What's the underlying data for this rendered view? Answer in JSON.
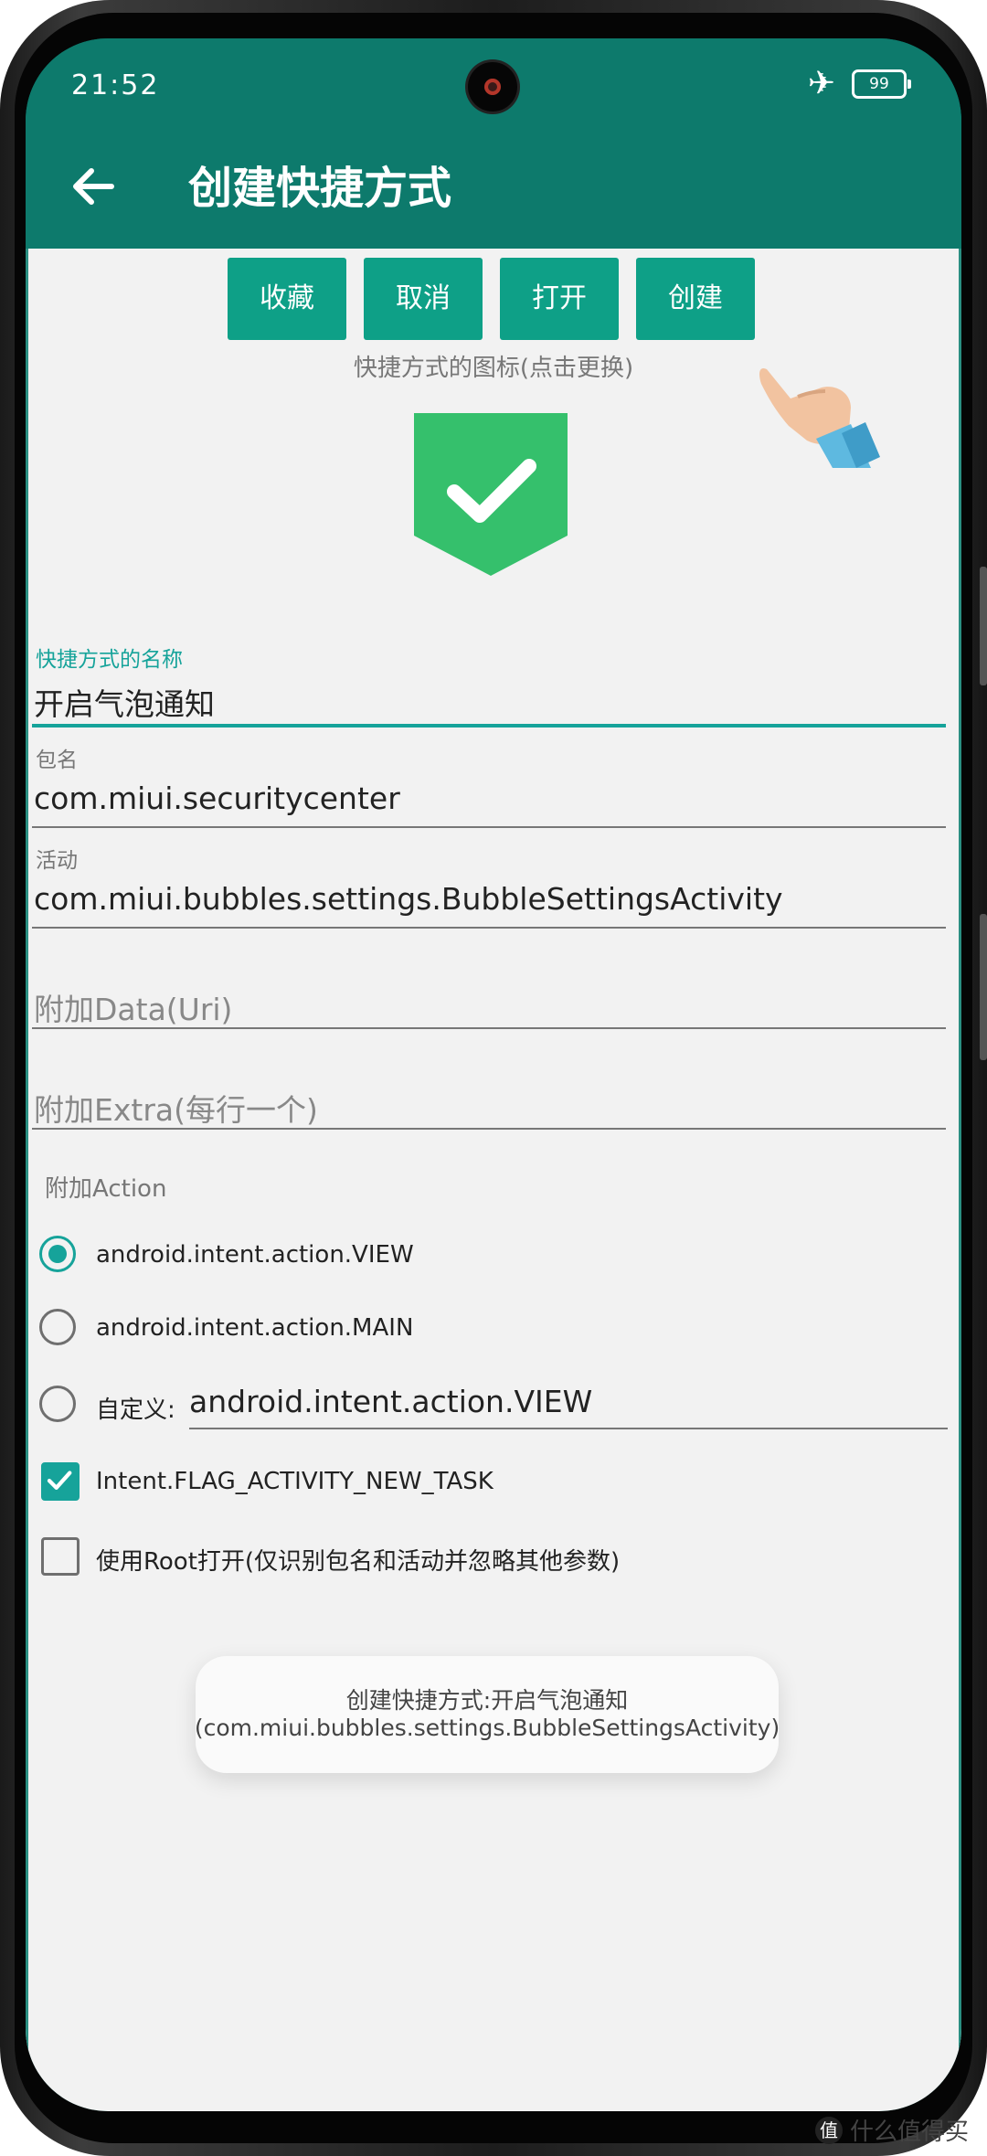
{
  "status_bar": {
    "time": "21:52",
    "battery": "99"
  },
  "app_bar": {
    "title": "创建快捷方式"
  },
  "buttons": {
    "favorite": "收藏",
    "cancel": "取消",
    "open": "打开",
    "create": "创建"
  },
  "icon_hint": "快捷方式的图标(点击更换)",
  "fields": {
    "name": {
      "label": "快捷方式的名称",
      "value": "开启气泡通知"
    },
    "package": {
      "label": "包名",
      "value": "com.miui.securitycenter"
    },
    "activity": {
      "label": "活动",
      "value": "com.miui.bubbles.settings.BubbleSettingsActivity"
    },
    "data": {
      "placeholder": "附加Data(Uri)"
    },
    "extra": {
      "placeholder": "附加Extra(每行一个)"
    }
  },
  "action": {
    "label": "附加Action",
    "options": [
      {
        "label": "android.intent.action.VIEW",
        "checked": true
      },
      {
        "label": "android.intent.action.MAIN",
        "checked": false
      }
    ],
    "custom": {
      "label": "自定义:",
      "value": "android.intent.action.VIEW",
      "checked": false
    }
  },
  "flags": [
    {
      "label": "Intent.FLAG_ACTIVITY_NEW_TASK",
      "checked": true
    },
    {
      "label": "使用Root打开(仅识别包名和活动并忽略其他参数)",
      "checked": false
    }
  ],
  "toast": "创建快捷方式:开启气泡通知(com.miui.bubbles.settings.BubbleSettingsActivity)",
  "watermark": "什么值得买",
  "colors": {
    "primary": "#0d7a6c",
    "accent": "#16a39a",
    "button": "#0ea087",
    "icon_green": "#35c06c"
  },
  "icons": {
    "back": "arrow-left",
    "airplane": "airplane-mode",
    "check": "checkmark"
  }
}
